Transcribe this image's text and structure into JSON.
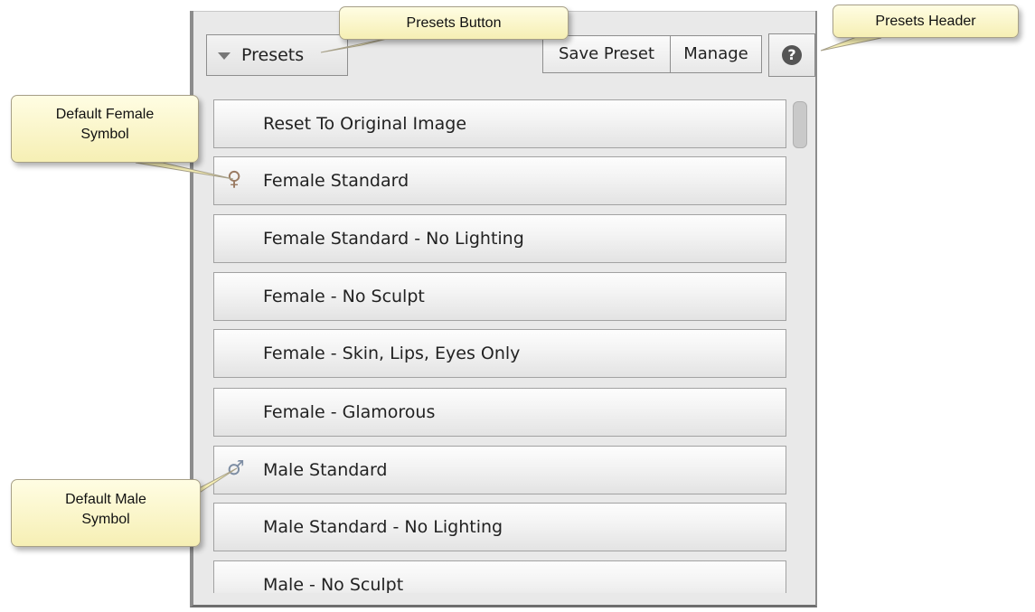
{
  "header": {
    "presets_label": "Presets",
    "save_preset_label": "Save Preset",
    "manage_label": "Manage",
    "help_glyph": "?"
  },
  "presets": [
    {
      "label": "Reset To Original Image",
      "symbol": ""
    },
    {
      "label": "Female Standard",
      "symbol": "female-icon"
    },
    {
      "label": "Female Standard - No Lighting",
      "symbol": ""
    },
    {
      "label": "Female - No Sculpt",
      "symbol": ""
    },
    {
      "label": "Female - Skin, Lips, Eyes Only",
      "symbol": ""
    },
    {
      "label": "Female - Glamorous",
      "symbol": ""
    },
    {
      "label": "Male Standard",
      "symbol": "male-icon"
    },
    {
      "label": "Male Standard - No Lighting",
      "symbol": ""
    },
    {
      "label": "Male - No Sculpt",
      "symbol": ""
    }
  ],
  "callouts": {
    "presets_button": "Presets Button",
    "presets_header": "Presets Header",
    "female_symbol_line1": "Default Female",
    "female_symbol_line2": "Symbol",
    "male_symbol_line1": "Default Male",
    "male_symbol_line2": "Symbol"
  },
  "colors": {
    "female_symbol": "#9a7b63",
    "male_symbol": "#7d8da3",
    "callout_fill": "#f6efb4"
  }
}
